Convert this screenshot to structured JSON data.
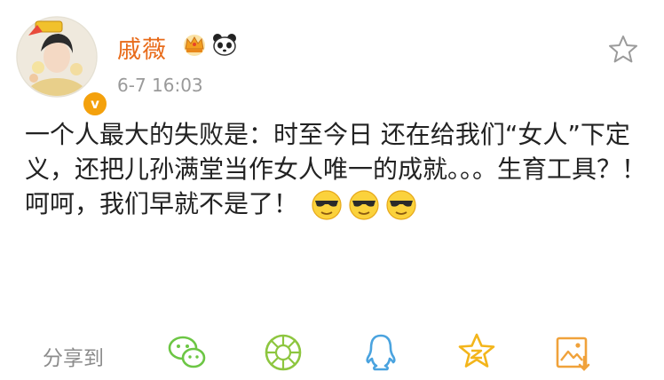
{
  "post": {
    "author": "戚薇",
    "verified_mark": "v",
    "timestamp": "6-7 16:03",
    "text": "一个人最大的失败是：时至今日 还在给我们“女人”下定义，还把儿孙满堂当作女人唯一的成就。。。生育工具？！ 呵呵，我们早就不是了！",
    "badge_icons": [
      "crown-icon",
      "panda-icon"
    ],
    "emoji_icons": [
      "sunglasses-emoji",
      "sunglasses-emoji",
      "sunglasses-emoji"
    ]
  },
  "actions": {
    "favorite_icon": "star-outline-icon"
  },
  "share": {
    "label": "分享到",
    "targets": [
      "wechat-icon",
      "moments-icon",
      "qq-icon",
      "qzone-icon",
      "image-save-icon"
    ]
  },
  "colors": {
    "author": "#e86b1a",
    "timestamp": "#9a9a9a",
    "text": "#222222",
    "share_label": "#8c8c8c",
    "wechat": "#6cc644",
    "moments": "#8dc63f",
    "qq": "#4aa3df",
    "qzone": "#f3b51b",
    "save": "#f0a23b",
    "verify": "#f4a10c"
  }
}
